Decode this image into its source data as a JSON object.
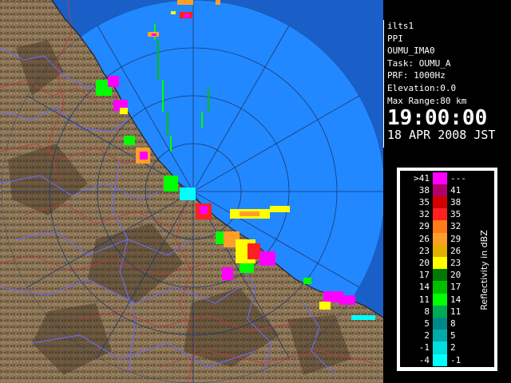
{
  "info": {
    "site": "ilts1",
    "product": "PPI",
    "radar": "OUMU_IMA0",
    "task": "Task: OUMU_A",
    "prf": "PRF: 1000Hz",
    "elevation": "Elevation:0.0",
    "max_range": "Max Range:80 km",
    "time": "19:00:00",
    "date": "18 APR 2008 JST"
  },
  "legend": {
    "title": "Reflectivity in dBZ",
    "rows": [
      {
        "low": ">41",
        "high": "---",
        "color": "#ff00ff"
      },
      {
        "low": "38",
        "high": "41",
        "color": "#b0006e"
      },
      {
        "low": "35",
        "high": "38",
        "color": "#d40000"
      },
      {
        "low": "32",
        "high": "35",
        "color": "#ff2020"
      },
      {
        "low": "29",
        "high": "32",
        "color": "#ff7a1a"
      },
      {
        "low": "26",
        "high": "29",
        "color": "#ff9f2a"
      },
      {
        "low": "23",
        "high": "26",
        "color": "#e3b000"
      },
      {
        "low": "20",
        "high": "23",
        "color": "#ffff00"
      },
      {
        "low": "17",
        "high": "20",
        "color": "#007a00"
      },
      {
        "low": "14",
        "high": "17",
        "color": "#00c000"
      },
      {
        "low": "11",
        "high": "14",
        "color": "#00ff00"
      },
      {
        "low": "8",
        "high": "11",
        "color": "#00aa55"
      },
      {
        "low": "5",
        "high": "8",
        "color": "#008888"
      },
      {
        "low": "2",
        "high": "5",
        "color": "#00aaaa"
      },
      {
        "low": "-1",
        "high": "2",
        "color": "#00dddd"
      },
      {
        "low": "-4",
        "high": "-1",
        "color": "#00ffff"
      }
    ]
  },
  "map_colors": {
    "land": "#8a7456",
    "land_dark": "#5e4b35",
    "sea_outside_range": "#1a5fc8",
    "sea_in_range": "#2288ff",
    "rivers": "#6a6af0",
    "range_rings": "#1a3a70"
  }
}
